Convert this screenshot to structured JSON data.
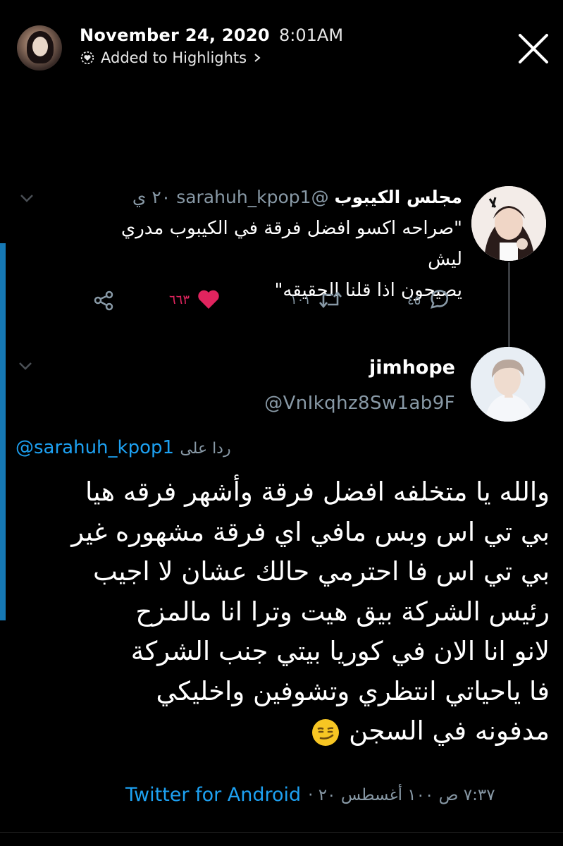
{
  "story": {
    "date": "November 24, 2020",
    "time": "8:01AM",
    "subtitle": "Added to Highlights"
  },
  "tweet1": {
    "name": "مجلس الكيبوب",
    "handle": "@sarahuh_kpop1",
    "age": "٢٠ ي",
    "text_line1": "\"صراحه اكسو افضل فرقة في الكيبوب مدري ليش",
    "text_line2": "يصيحون اذا قلنا الحقيقه\"",
    "likes": "٦٦٣",
    "retweets": "١٠١",
    "replies": "٤٥",
    "like_color": "#e0245e"
  },
  "tweet2": {
    "name": "jimhope",
    "handle": "@VnIkqhz8Sw1ab9F",
    "reply_prefix": "ردا على",
    "reply_handle": "@sarahuh_kpop1",
    "lines": [
      "والله يا متخلفه افضل فرقة وأشهر فرقه هيا",
      "بي تي اس وبس مافي اي فرقة مشهوره غير",
      "بي تي اس فا احترمي حالك عشان لا اجيب",
      "رئيس الشركة بيق هيت وترا انا مالمزح",
      "لانو انا الان في كوريا بيتي جنب الشركة",
      "فا ياحياتي انتظري وتشوفين واخليكي",
      "مدفونه في السجن"
    ],
    "timestamp": "٧:٣٧ ص ١٠٠ أغسطس ٢٠ ·",
    "source": "Twitter for Android"
  },
  "colors": {
    "accent": "#1da1f2",
    "muted": "#8899a6",
    "background": "#000000"
  },
  "icons": [
    "highlight-icon",
    "chevron-right-icon",
    "close-icon",
    "chevron-down-icon",
    "share-icon",
    "heart-icon",
    "retweet-icon",
    "reply-icon",
    "smirk-emoji-icon"
  ]
}
